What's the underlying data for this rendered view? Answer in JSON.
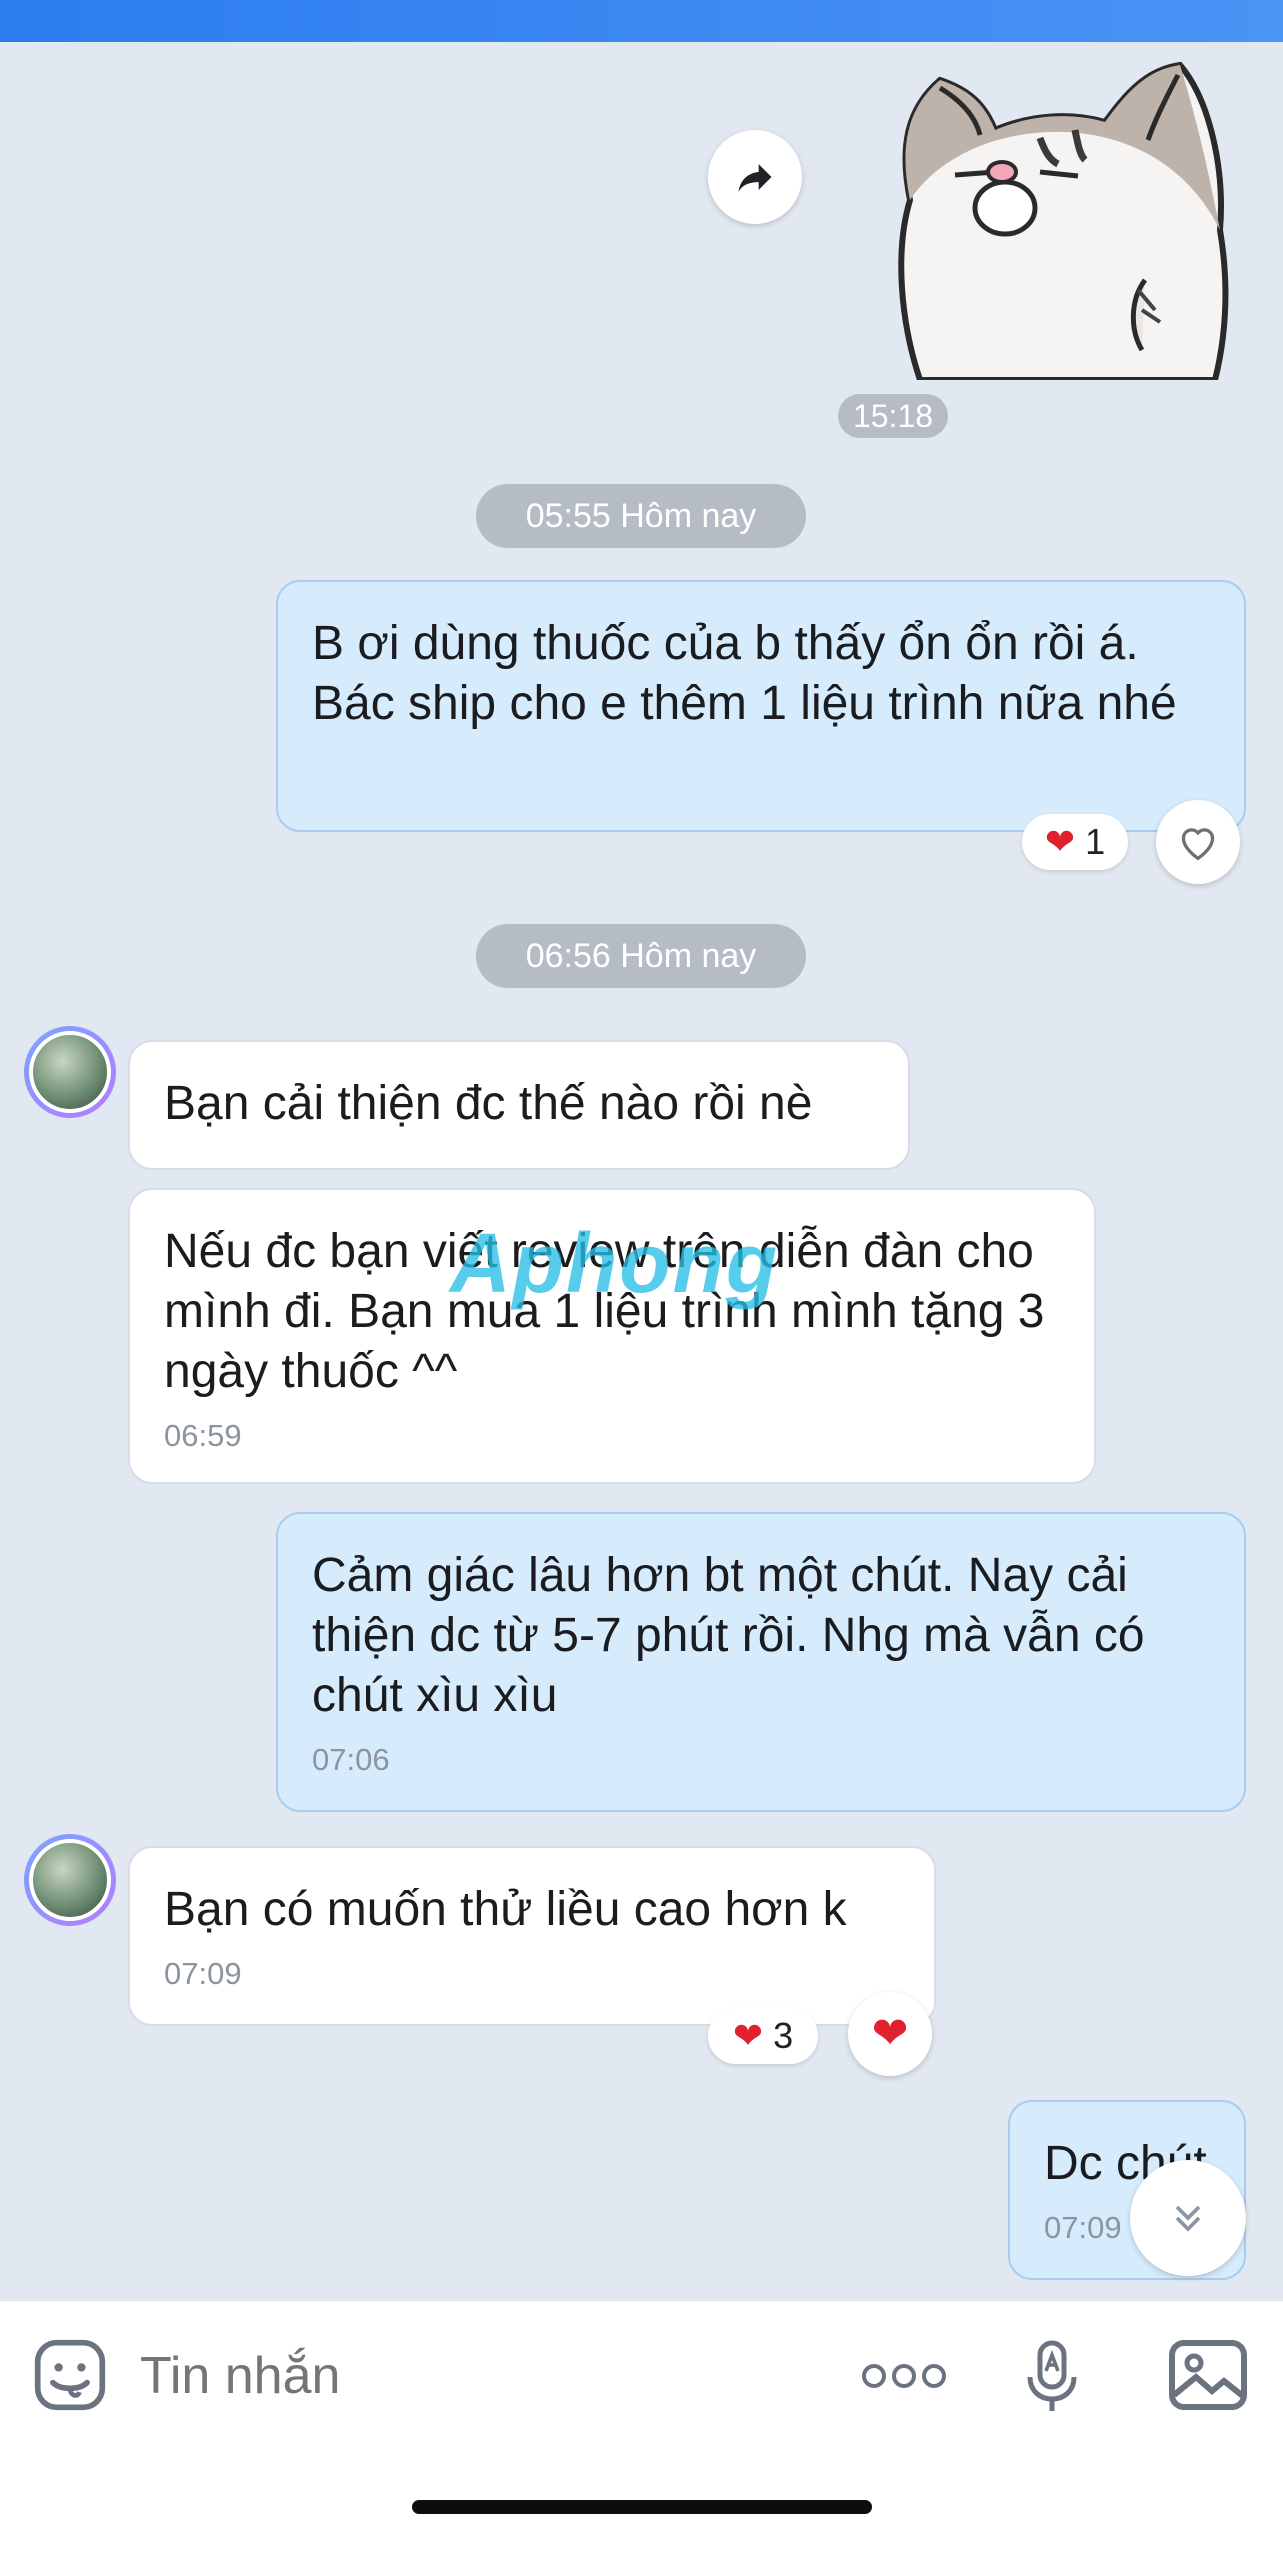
{
  "sticker": {
    "time": "15:18"
  },
  "dividers": [
    "05:55 Hôm nay",
    "06:56 Hôm nay"
  ],
  "messages": [
    {
      "text": "B ơi dùng thuốc của b thấy ổn ổn rồi á. Bác ship cho e thêm 1 liệu trình nữa nhé",
      "reaction_count": "1"
    },
    {
      "text": "Bạn cải thiện đc thế nào rồi nè"
    },
    {
      "text": "Nếu đc bạn viết review trên diễn đàn cho mình đi. Bạn mua 1 liệu trình mình tặng 3 ngày thuốc ^^",
      "time": "06:59"
    },
    {
      "text": "Cảm giác lâu hơn bt một chút. Nay cải thiện dc từ 5-7 phút rồi. Nhg mà vẫn có chút xìu xìu",
      "time": "07:06"
    },
    {
      "text": "Bạn có muốn thử liều cao hơn k",
      "time": "07:09",
      "reaction_count": "3"
    },
    {
      "text": "Dc chút",
      "time": "07:09"
    }
  ],
  "watermark": "Aphong",
  "input": {
    "placeholder": "Tin nhắn"
  },
  "colors": {
    "accent": "#2c7cf0",
    "outgoing_bubble": "#d6ebfb",
    "incoming_bubble": "#ffffff",
    "heart": "#e0222f"
  }
}
